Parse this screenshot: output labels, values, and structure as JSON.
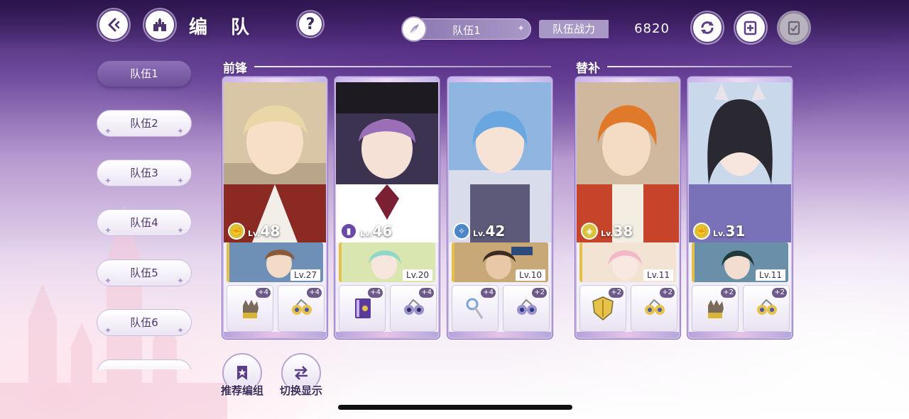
{
  "header": {
    "title": "编 队",
    "team_selector": "队伍1",
    "power_label": "队伍战力",
    "power_value": "6820"
  },
  "sidebar": {
    "tabs": [
      {
        "label": "队伍1",
        "active": true
      },
      {
        "label": "队伍2",
        "active": false
      },
      {
        "label": "队伍3",
        "active": false
      },
      {
        "label": "队伍4",
        "active": false
      },
      {
        "label": "队伍5",
        "active": false
      },
      {
        "label": "队伍6",
        "active": false
      }
    ]
  },
  "sections": {
    "front": "前锋",
    "reserve": "替补"
  },
  "cards": [
    {
      "level_prefix": "Lv.",
      "level": "48",
      "class_icon": "fist-icon",
      "sub_level": "Lv.27",
      "equip1_plus": "+4",
      "equip2_plus": "+4",
      "equip1_icon": "gauntlet-icon",
      "equip2_icon": "earring-icon"
    },
    {
      "level_prefix": "Lv.",
      "level": "46",
      "class_icon": "book-icon",
      "sub_level": "Lv.20",
      "equip1_plus": "+4",
      "equip2_plus": "+4",
      "equip1_icon": "spellbook-icon",
      "equip2_icon": "earring-icon"
    },
    {
      "level_prefix": "Lv.",
      "level": "42",
      "class_icon": "wand-icon",
      "sub_level": "Lv.10",
      "equip1_plus": "+4",
      "equip2_plus": "+2",
      "equip1_icon": "wand-icon",
      "equip2_icon": "earring-icon"
    },
    {
      "level_prefix": "Lv.",
      "level": "38",
      "class_icon": "shield-icon",
      "sub_level": "Lv.11",
      "equip1_plus": "+2",
      "equip2_plus": "+2",
      "equip1_icon": "shield-icon",
      "equip2_icon": "earring-icon"
    },
    {
      "level_prefix": "Lv.",
      "level": "31",
      "class_icon": "fist-icon",
      "sub_level": "Lv.11",
      "equip1_plus": "+2",
      "equip2_plus": "+2",
      "equip1_icon": "gauntlet-icon",
      "equip2_icon": "earring-icon"
    }
  ],
  "bottom": {
    "recommend_label": "推荐编组",
    "switch_label": "切换显示"
  },
  "colors": {
    "accent_purple": "#6e5198",
    "card_border": "#c9b8e6",
    "sub_border_gold": "#e4c04a"
  }
}
